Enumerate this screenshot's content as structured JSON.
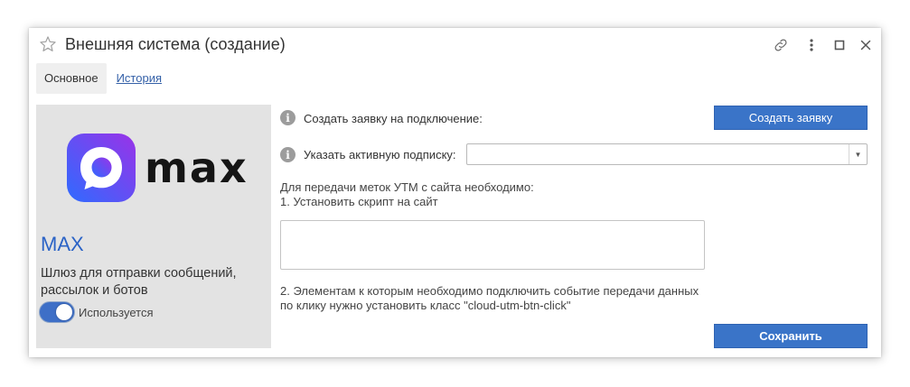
{
  "window": {
    "title": "Внешняя система (создание)"
  },
  "tabs": [
    {
      "label": "Основное",
      "active": true
    },
    {
      "label": "История",
      "active": false
    }
  ],
  "system": {
    "logo_text": "max",
    "name": "MAX",
    "description": "Шлюз для отправки сообщений, рассылок и ботов",
    "toggle_label": "Используется",
    "toggle_on": true
  },
  "form": {
    "request_label": "Создать заявку на подключение:",
    "request_button": "Создать заявку",
    "subscription_label": "Указать активную подписку:",
    "subscription_value": "",
    "utm_intro": "Для передачи меток УТМ с сайта необходимо:",
    "utm_step1": "1. Установить скрипт на сайт",
    "script_value": "",
    "utm_step2_line1": "2. Элементам к которым необходимо подключить событие передачи данных",
    "utm_step2_line2": "по клику нужно установить класс \"cloud-utm-btn-click\"",
    "save_button": "Сохранить"
  },
  "icons": {
    "favorite": "star-icon",
    "link": "link-icon",
    "more": "more-vertical-icon",
    "maximize": "maximize-icon",
    "close": "close-icon",
    "info": "info-icon"
  },
  "colors": {
    "accent": "#3a74c8",
    "link": "#3561a8",
    "system_name": "#2b63c6",
    "panel_bg": "#e3e3e3",
    "logo_gradient_start": "#2f6bff",
    "logo_gradient_end": "#9a32e8"
  }
}
